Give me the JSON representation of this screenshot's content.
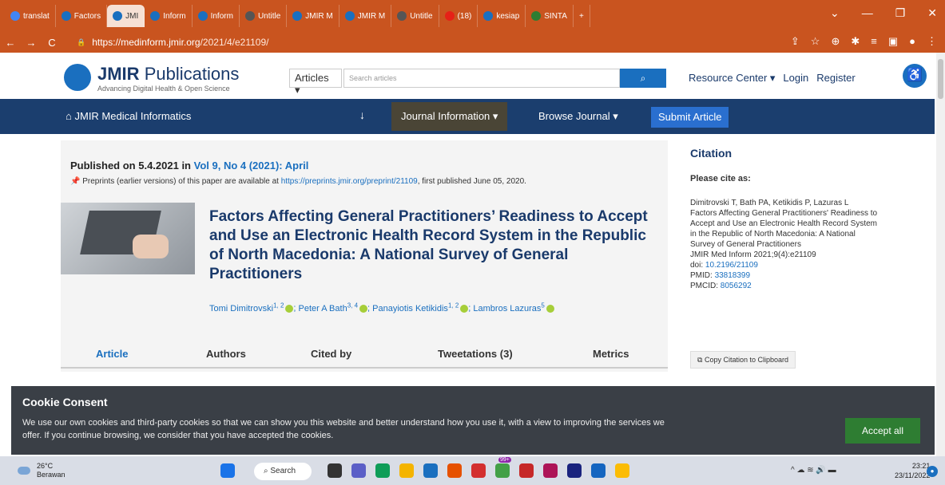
{
  "browser": {
    "tabs": [
      {
        "label": "translat",
        "color": "#4285f4"
      },
      {
        "label": "Factors",
        "color": "#1a6fbf"
      },
      {
        "label": "JMI",
        "color": "#1a6fbf"
      },
      {
        "label": "Inform",
        "color": "#1a6fbf"
      },
      {
        "label": "Inform",
        "color": "#1a6fbf"
      },
      {
        "label": "Untitle",
        "color": "#555555"
      },
      {
        "label": "JMIR M",
        "color": "#1a6fbf"
      },
      {
        "label": "JMIR M",
        "color": "#1a6fbf"
      },
      {
        "label": "Untitle",
        "color": "#555555"
      },
      {
        "label": "(18)",
        "color": "#e62117"
      },
      {
        "label": "kesiap",
        "color": "#1a6fbf"
      },
      {
        "label": "SINTA",
        "color": "#2e7d32"
      }
    ],
    "url_host": "https://medinform.jmir.org",
    "url_path": "/2021/4/e21109/"
  },
  "header": {
    "logo_bold": "JMIR",
    "logo_rest": "Publications",
    "tagline": "Advancing Digital Health & Open Science",
    "articles_label": "Articles",
    "search_placeholder": "Search articles",
    "resource_center": "Resource Center",
    "login": "Login",
    "register": "Register"
  },
  "journal_nav": {
    "home": "JMIR Medical Informatics",
    "journal_information": "Journal Information",
    "browse_journal": "Browse Journal",
    "submit_article": "Submit Article"
  },
  "article": {
    "published_prefix": "Published on 5.4.2021 in",
    "issue_link": "Vol 9, No 4 (2021): April",
    "preprint_prefix": "Preprints (earlier versions) of this paper are available at",
    "preprint_link": "https://preprints.jmir.org/preprint/21109",
    "preprint_suffix": ", first published June 05, 2020.",
    "title": "Factors Affecting General Practitioners’ Readiness to Accept and Use an Electronic Health Record System in the Republic of North Macedonia: A National Survey of General Practitioners",
    "authors": [
      {
        "name": "Tomi Dimitrovski",
        "sup": "1, 2"
      },
      {
        "name": "Peter A Bath",
        "sup": "3, 4"
      },
      {
        "name": "Panayiotis Ketikidis",
        "sup": "1, 2"
      },
      {
        "name": "Lambros Lazuras",
        "sup": "5"
      }
    ],
    "tabs": [
      "Article",
      "Authors",
      "Cited by",
      "Tweetations (3)",
      "Metrics"
    ]
  },
  "citation": {
    "heading": "Citation",
    "please_cite": "Please cite as:",
    "authors": "Dimitrovski T, Bath PA, Ketikidis P, Lazuras L",
    "title": "Factors Affecting General Practitioners' Readiness to Accept and Use an Electronic Health Record System in the Republic of North Macedonia: A National Survey of General Practitioners",
    "journal": "JMIR Med Inform 2021;9(4):e21109",
    "doi_label": "doi:",
    "doi": "10.2196/21109",
    "pmid_label": "PMID:",
    "pmid": "33818399",
    "pmcid_label": "PMCID:",
    "pmcid": "8056292",
    "copy_button": "Copy Citation to Clipboard"
  },
  "cookie": {
    "title": "Cookie Consent",
    "text": "We use our own cookies and third-party cookies so that we can show you this website and better understand how you use it, with a view to improving the services we offer. If you continue browsing, we consider that you have accepted the cookies.",
    "accept": "Accept all"
  },
  "taskbar": {
    "temp": "26°C",
    "weather": "Berawan",
    "search": "Search",
    "badge": "99+",
    "time": "23:21",
    "date": "23/11/2022"
  }
}
